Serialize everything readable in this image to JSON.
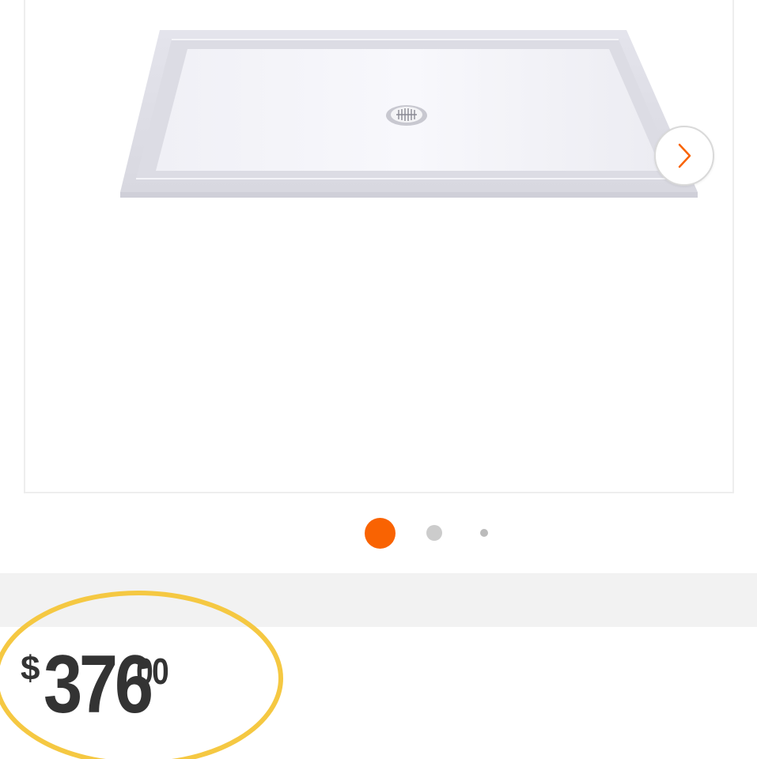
{
  "gallery": {
    "product_image_icon": "shower-base-image",
    "next_button_icon": "chevron-right-icon",
    "active_dot_color": "#f96302",
    "dots_count": 3,
    "active_dot": 1
  },
  "price": {
    "currency": "$",
    "dollars": "376",
    "cents": "00",
    "highlight_color": "#f5c842"
  }
}
